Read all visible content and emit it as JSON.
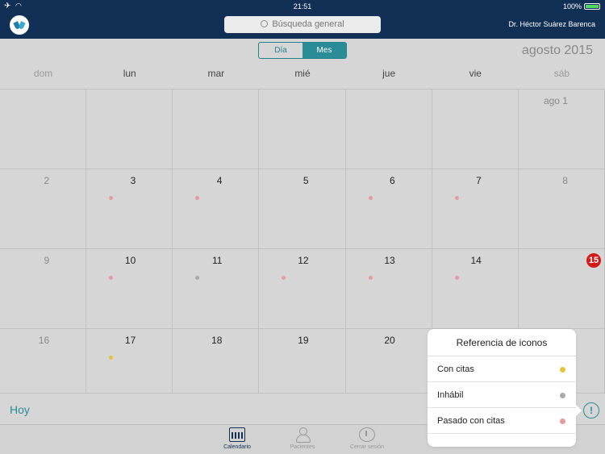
{
  "status": {
    "time": "21:51",
    "battery": "100%"
  },
  "header": {
    "search_placeholder": "Búsqueda general",
    "user": "Dr. Héctor Suárez Barenca"
  },
  "view_toggle": {
    "day": "Día",
    "month": "Mes",
    "selected": "Mes"
  },
  "month_label": "agosto 2015",
  "weekdays": [
    "dom",
    "lun",
    "mar",
    "mié",
    "jue",
    "vie",
    "sáb"
  ],
  "weeks": [
    [
      "",
      "",
      "",
      "",
      "",
      "",
      "ago  1"
    ],
    [
      "2",
      "3",
      "4",
      "5",
      "6",
      "7",
      "8"
    ],
    [
      "9",
      "10",
      "11",
      "12",
      "13",
      "14",
      "15"
    ],
    [
      "16",
      "17",
      "18",
      "19",
      "20",
      "",
      ""
    ]
  ],
  "today": "15",
  "colors": {
    "con_citas": "#e8c23a",
    "inhabil": "#a9a9a9",
    "pasado": "#e79aa0",
    "accent": "#2a8c96",
    "header": "#123055",
    "today": "#d11a1a"
  },
  "dots": [
    {
      "week": 1,
      "day": 1,
      "type": "pasado"
    },
    {
      "week": 1,
      "day": 2,
      "type": "pasado"
    },
    {
      "week": 1,
      "day": 4,
      "type": "pasado"
    },
    {
      "week": 1,
      "day": 5,
      "type": "pasado"
    },
    {
      "week": 2,
      "day": 1,
      "type": "pasado"
    },
    {
      "week": 2,
      "day": 2,
      "type": "inhabil"
    },
    {
      "week": 2,
      "day": 3,
      "type": "pasado"
    },
    {
      "week": 2,
      "day": 4,
      "type": "pasado"
    },
    {
      "week": 2,
      "day": 5,
      "type": "pasado"
    },
    {
      "week": 3,
      "day": 1,
      "type": "con_citas"
    }
  ],
  "hoy_label": "Hoy",
  "legend": {
    "title": "Referencia de iconos",
    "items": [
      {
        "label": "Con citas",
        "type": "con_citas"
      },
      {
        "label": "Inhábil",
        "type": "inhabil"
      },
      {
        "label": "Pasado con citas",
        "type": "pasado"
      }
    ]
  },
  "tabs": {
    "calendario": "Calendario",
    "pacientes": "Pacientes",
    "cerrar": "Cerrar sesión"
  },
  "info_glyph": "!"
}
